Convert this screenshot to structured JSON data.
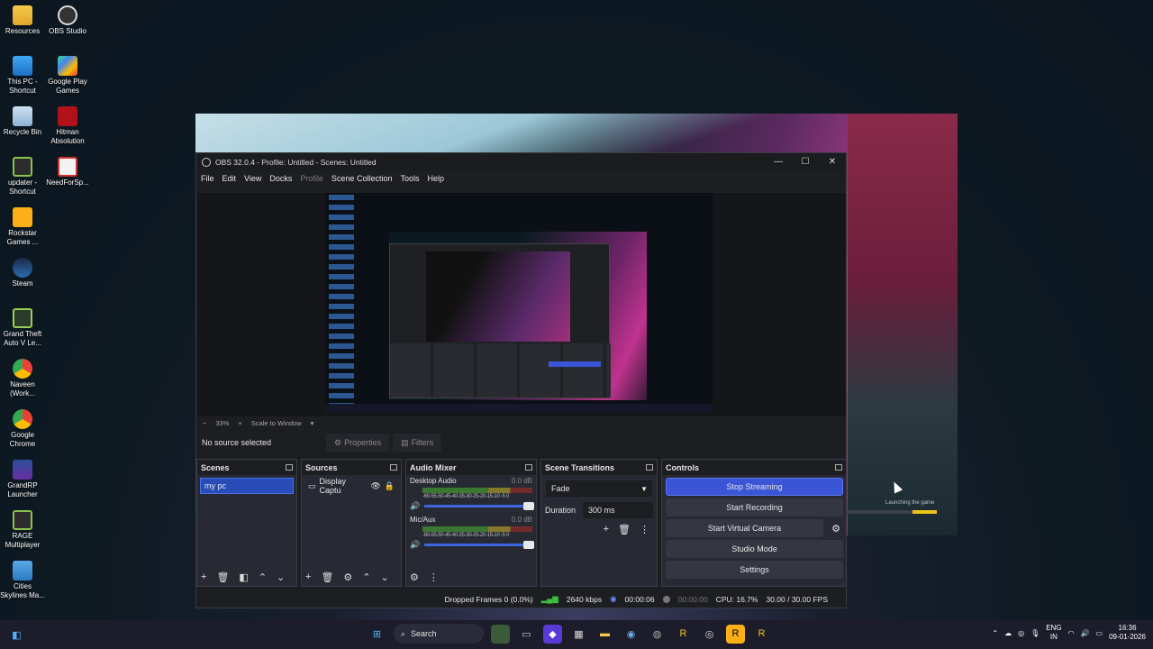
{
  "desktop": {
    "icons": [
      {
        "label": "Resources",
        "icon": "folder-icon"
      },
      {
        "label": "OBS Studio",
        "icon": "obs-icon"
      },
      {
        "label": "This PC - Shortcut",
        "icon": "computer-icon"
      },
      {
        "label": "Google Play Games",
        "icon": "google-play-games-icon"
      },
      {
        "label": "Recycle Bin",
        "icon": "recycle-bin-icon"
      },
      {
        "label": "Hitman Absolution",
        "icon": "hitman-icon"
      },
      {
        "label": "updater - Shortcut",
        "icon": "rage-updater-icon"
      },
      {
        "label": "NeedForSp...",
        "icon": "need-for-speed-icon"
      },
      {
        "label": "Rockstar Games ...",
        "icon": "rockstar-icon"
      },
      {
        "label": "Steam",
        "icon": "steam-icon"
      },
      {
        "label": "Grand Theft Auto V Le...",
        "icon": "gta-v-icon"
      },
      {
        "label": "Naveen (Work...",
        "icon": "chrome-profile-icon"
      },
      {
        "label": "Google Chrome",
        "icon": "chrome-icon"
      },
      {
        "label": "GrandRP Launcher",
        "icon": "grandrp-icon"
      },
      {
        "label": "RAGE Multiplayer",
        "icon": "rage-mp-icon"
      },
      {
        "label": "Cities Skylines Ma...",
        "icon": "cities-skylines-icon"
      }
    ]
  },
  "game_window": {
    "status": "Launching the game",
    "progress": 0.26
  },
  "obs": {
    "title": "OBS 32.0.4 - Profile: Untitled - Scenes: Untitled",
    "window_controls": {
      "minimize": "—",
      "maximize": "☐",
      "close": "✕"
    },
    "menu": [
      "File",
      "Edit",
      "View",
      "Docks",
      "Profile",
      "Scene Collection",
      "Tools",
      "Help"
    ],
    "zoom": {
      "minus": "−",
      "value": "33%",
      "plus": "+",
      "mode": "Scale to Window",
      "caret": "▾"
    },
    "source_toolbar": {
      "no_source": "No source selected",
      "properties": "Properties",
      "filters": "Filters"
    },
    "scenes": {
      "title": "Scenes",
      "items": [
        "my pc"
      ]
    },
    "sources": {
      "title": "Sources",
      "items": [
        "Display Captu"
      ]
    },
    "audio_mixer": {
      "title": "Audio Mixer",
      "scale": "-60-55-50-45-40-35-30-25-20-15-10 -5  0",
      "tracks": [
        {
          "name": "Desktop Audio",
          "db": "0.0 dB",
          "level": 0.82
        },
        {
          "name": "Mic/Aux",
          "db": "0.0 dB",
          "level": 0.82
        }
      ]
    },
    "scene_transitions": {
      "title": "Scene Transitions",
      "transition": "Fade",
      "duration_label": "Duration",
      "duration_value": "300 ms"
    },
    "controls": {
      "title": "Controls",
      "stop_streaming": "Stop Streaming",
      "start_recording": "Start Recording",
      "start_virtual_camera": "Start Virtual Camera",
      "studio_mode": "Studio Mode",
      "settings": "Settings"
    },
    "status": {
      "dropped_frames": "Dropped Frames 0 (0.0%)",
      "bitrate": "2640 kbps",
      "stream_time": "00:00:06",
      "record_time": "00:00:00",
      "cpu": "CPU: 16.7%",
      "fps": "30.00 / 30.00 FPS"
    },
    "accent_color": "#3a55d6"
  },
  "taskbar": {
    "search_label": "Search",
    "language": {
      "line1": "ENG",
      "line2": "IN"
    },
    "clock": {
      "time": "16:36",
      "date": "09-01-2026"
    }
  }
}
